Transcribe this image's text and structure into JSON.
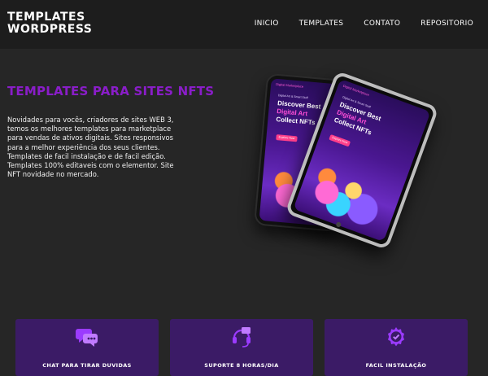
{
  "header": {
    "logo_line1": "TEMPLATES",
    "logo_line2": "WORDPRESS",
    "nav": [
      "INICIO",
      "TEMPLATES",
      "CONTATO",
      "REPOSITORIO"
    ]
  },
  "hero": {
    "title": "TEMPLATES PARA SITES NFTS",
    "text": "Novidades para vocês, criadores de sites WEB 3, temos os melhores templates para marketplace para vendas de ativos digitais. Sites responsivos para a melhor experiência dos seus clientes. Templates de facil instalação e de facil edição. Templates 100% editaveis com o elementor. Site NFT novidade no mercado."
  },
  "mockup": {
    "brand": "Digital Marketplace",
    "small": "Digital Art & Smart Stuff",
    "line1": "Discover Best",
    "line2": "Digital Art",
    "line3": "Collect NFTs",
    "button": "Explore Now"
  },
  "cards": [
    {
      "label": "CHAT PARA TIRAR DUVIDAS",
      "icon": "chat-bubbles-icon"
    },
    {
      "label": "SUPORTE 8 HORAS/DIA",
      "icon": "headset-support-icon"
    },
    {
      "label": "FACIL INSTALAÇÃO",
      "icon": "gear-check-icon"
    }
  ],
  "colors": {
    "background": "#262626",
    "header": "#1d1d1d",
    "accent": "#8a1dc9",
    "card": "#3b1b66",
    "icon": "#9b3bff"
  }
}
